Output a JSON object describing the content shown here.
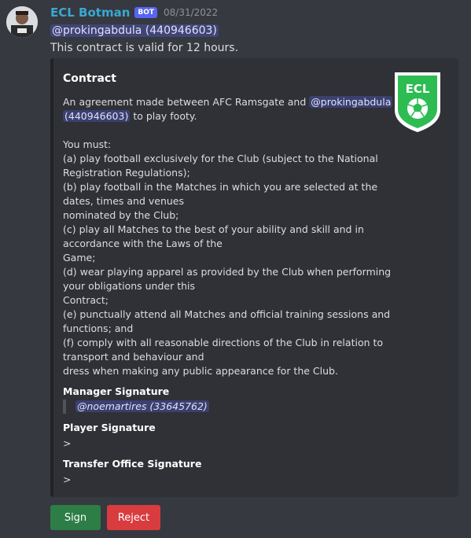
{
  "message": {
    "author": "ECL Botman",
    "bot_tag": "BOT",
    "timestamp": "08/31/2022",
    "mention": "@prokingabdula (440946603)",
    "content": "This contract is valid for 12 hours."
  },
  "embed": {
    "title": "Contract",
    "thumbnail_text": "ECL",
    "desc_line1_pre": "An agreement made between AFC Ramsgate and ",
    "desc_line1_mention": "@prokingabdula",
    "desc_line2_mention": "(440946603)",
    "desc_line2_post": " to play footy.",
    "you_must": "You must:",
    "clauses": [
      "(a) play football exclusively for the Club (subject to the National",
      "Registration Regulations);",
      "(b) play football in the Matches in which you are selected at the",
      "dates, times and venues",
      "nominated by the Club;",
      "(c) play all Matches to the best of your ability and skill and in",
      "accordance with the Laws of the",
      "Game;",
      "(d) wear playing apparel as provided by the Club when performing",
      "your obligations under this",
      "Contract;",
      "(e) punctually attend all Matches and official training sessions and",
      "functions; and",
      "(f) comply with all reasonable directions of the Club in relation to",
      "transport and behaviour and",
      "dress when making any public appearance for the Club."
    ],
    "fields": {
      "manager_label": "Manager Signature",
      "manager_value": "@noemartires (33645762)",
      "player_label": "Player Signature",
      "player_value": ">",
      "transfer_label": "Transfer Office Signature",
      "transfer_value": ">"
    }
  },
  "buttons": {
    "sign": "Sign",
    "reject": "Reject"
  },
  "colors": {
    "sign": "#2d7d46",
    "reject": "#d83c3e",
    "badge_green": "#2dbc52"
  }
}
